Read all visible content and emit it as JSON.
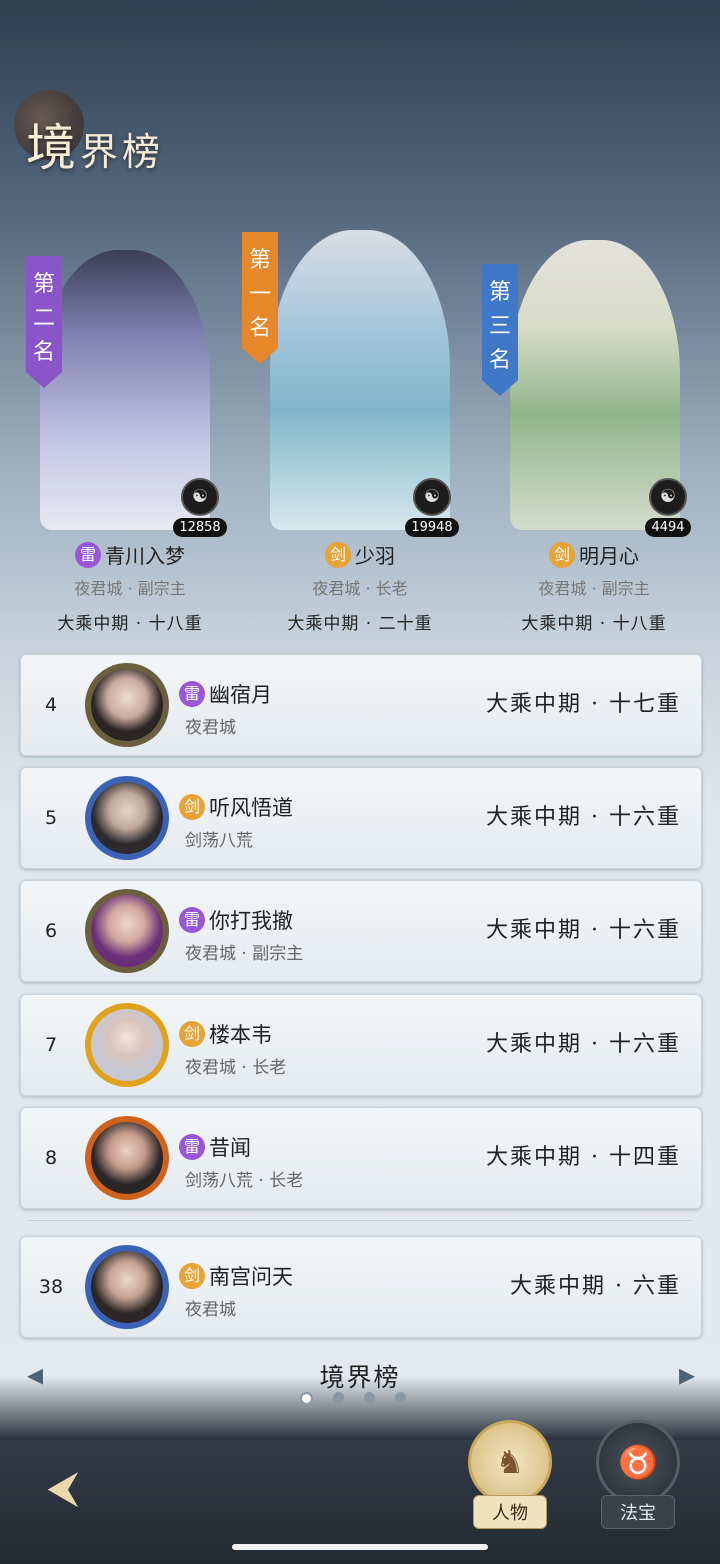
{
  "header": {
    "title_big": "境",
    "title_small": "界榜"
  },
  "top3": [
    {
      "place_label": "第二名",
      "place_color": "#8a55c9",
      "badge": "雷",
      "badge_type": "lei",
      "name": "青川入梦",
      "sect": "夜君城 · 副宗主",
      "realm": "大乘中期 · 十八重",
      "score": "12858",
      "score_icon": "taiji-icon"
    },
    {
      "place_label": "第一名",
      "place_color": "#e8862a",
      "badge": "剑",
      "badge_type": "jian",
      "name": "少羽",
      "sect": "夜君城 · 长老",
      "realm": "大乘中期 · 二十重",
      "score": "19948",
      "score_icon": "taiji-icon"
    },
    {
      "place_label": "第三名",
      "place_color": "#3f78c8",
      "badge": "剑",
      "badge_type": "jian",
      "name": "明月心",
      "sect": "夜君城 · 副宗主",
      "realm": "大乘中期 · 十八重",
      "score": "4494",
      "score_icon": "taiji-icon"
    }
  ],
  "rows": [
    {
      "rank": "4",
      "badge": "雷",
      "badge_type": "lei",
      "name": "幽宿月",
      "sect": "夜君城",
      "realm": "大乘中期 · 十七重"
    },
    {
      "rank": "5",
      "badge": "剑",
      "badge_type": "jian",
      "name": "听风悟道",
      "sect": "剑荡八荒",
      "realm": "大乘中期 · 十六重"
    },
    {
      "rank": "6",
      "badge": "雷",
      "badge_type": "lei",
      "name": "你打我撤",
      "sect": "夜君城 · 副宗主",
      "realm": "大乘中期 · 十六重"
    },
    {
      "rank": "7",
      "badge": "剑",
      "badge_type": "jian",
      "name": "楼本韦",
      "sect": "夜君城 · 长老",
      "realm": "大乘中期 · 十六重"
    },
    {
      "rank": "8",
      "badge": "雷",
      "badge_type": "lei",
      "name": "昔闻",
      "sect": "剑荡八荒 · 长老",
      "realm": "大乘中期 · 十四重"
    }
  ],
  "self_row": {
    "rank": "38",
    "badge": "剑",
    "badge_type": "jian",
    "name": "南宫问天",
    "sect": "夜君城",
    "realm": "大乘中期 · 六重"
  },
  "footer": {
    "title": "境界榜",
    "page_count": 4,
    "active_page": 1
  },
  "nav": {
    "character_label": "人物",
    "treasure_label": "法宝"
  },
  "icons": {
    "back": "back-arrow-icon",
    "prev": "chevron-left-icon",
    "next": "chevron-right-icon",
    "character": "character-silhouette-icon",
    "treasure": "gourd-icon"
  }
}
